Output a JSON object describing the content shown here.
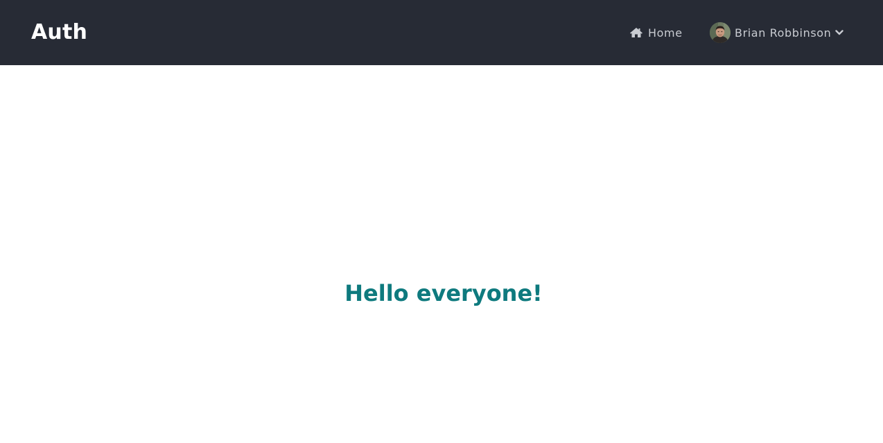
{
  "navbar": {
    "brand": "Auth",
    "home_label": "Home",
    "home_icon": "home-icon",
    "user_name": "Brian Robbinson",
    "user_menu_icon": "chevron-down-icon",
    "background_color": "#272b35"
  },
  "main": {
    "heading": "Hello everyone!",
    "heading_color": "#0e7a7e"
  }
}
